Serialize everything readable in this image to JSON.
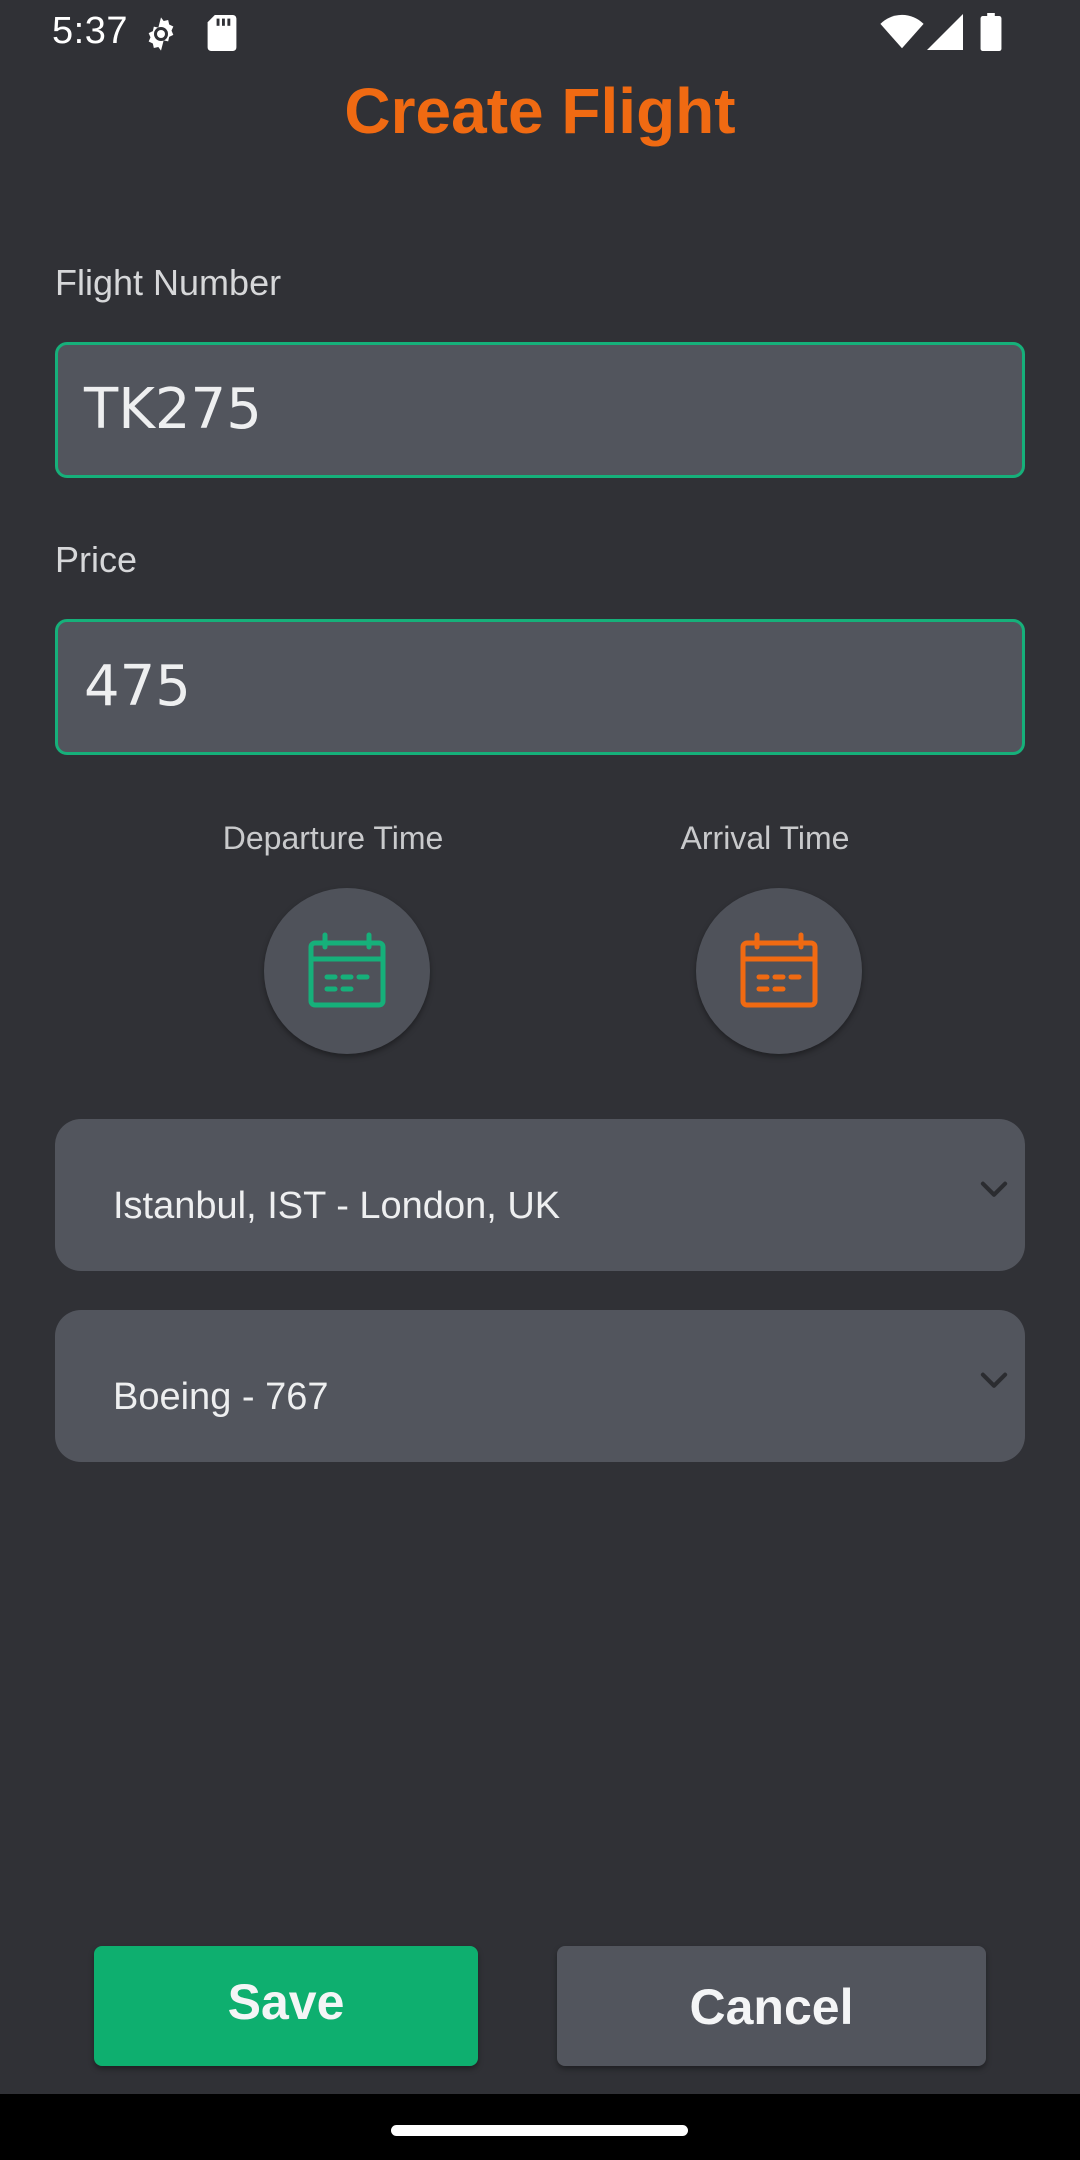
{
  "status_bar": {
    "time": "5:37",
    "icons": [
      "gear-icon",
      "sd-card-icon",
      "wifi-icon",
      "cell-signal-icon",
      "battery-icon"
    ]
  },
  "page": {
    "title": "Create Flight"
  },
  "form": {
    "flight_number": {
      "label": "Flight Number",
      "value": "TK275"
    },
    "price": {
      "label": "Price",
      "value": "475"
    },
    "departure_time": {
      "label": "Departure Time",
      "icon": "calendar-icon"
    },
    "arrival_time": {
      "label": "Arrival Time",
      "icon": "calendar-icon"
    },
    "route": {
      "selected": "Istanbul, IST - London, UK"
    },
    "aircraft": {
      "selected": "Boeing - 767"
    }
  },
  "actions": {
    "save_label": "Save",
    "cancel_label": "Cancel"
  },
  "colors": {
    "background": "#303136",
    "accent_orange": "#f06a12",
    "accent_green": "#0eaf6f",
    "field_bg": "#52555d"
  }
}
